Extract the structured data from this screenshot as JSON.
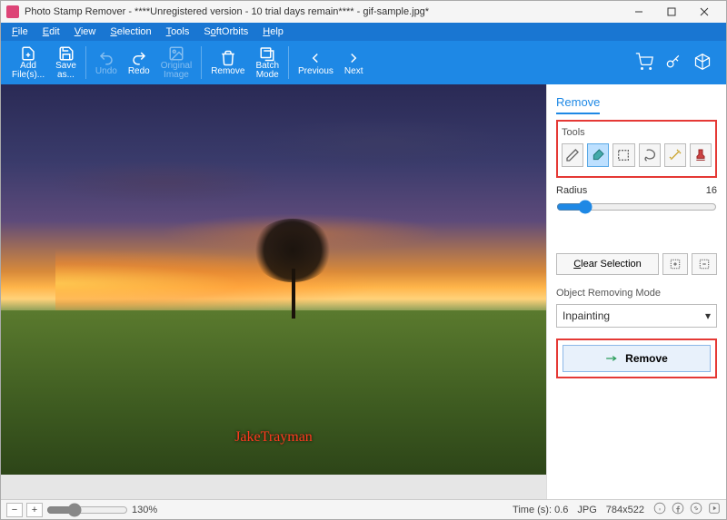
{
  "titlebar": {
    "title": "Photo Stamp Remover - ****Unregistered version - 10 trial days remain**** - gif-sample.jpg*"
  },
  "menu": {
    "file": "File",
    "edit": "Edit",
    "view": "View",
    "selection": "Selection",
    "tools": "Tools",
    "softorbits": "SoftOrbits",
    "help": "Help"
  },
  "toolbar": {
    "add": "Add\nFile(s)...",
    "save": "Save\nas...",
    "undo": "Undo",
    "redo": "Redo",
    "original": "Original\nImage",
    "remove": "Remove",
    "batch": "Batch\nMode",
    "previous": "Previous",
    "next": "Next"
  },
  "side": {
    "tab": "Remove",
    "tools_label": "Tools",
    "tools": {
      "pencil": "pencil",
      "marker": "marker",
      "rect": "rectangle-select",
      "lasso": "lasso",
      "magic": "magic-wand",
      "stamp": "color-stamp"
    },
    "radius_label": "Radius",
    "radius_value": "16",
    "clear": "Clear Selection",
    "mode_label": "Object Removing Mode",
    "mode_value": "Inpainting",
    "remove_btn": "Remove"
  },
  "status": {
    "zoom": "130%",
    "time": "Time (s): 0.6",
    "format": "JPG",
    "dims": "784x522"
  },
  "image": {
    "watermark": "JakeTrayman"
  }
}
